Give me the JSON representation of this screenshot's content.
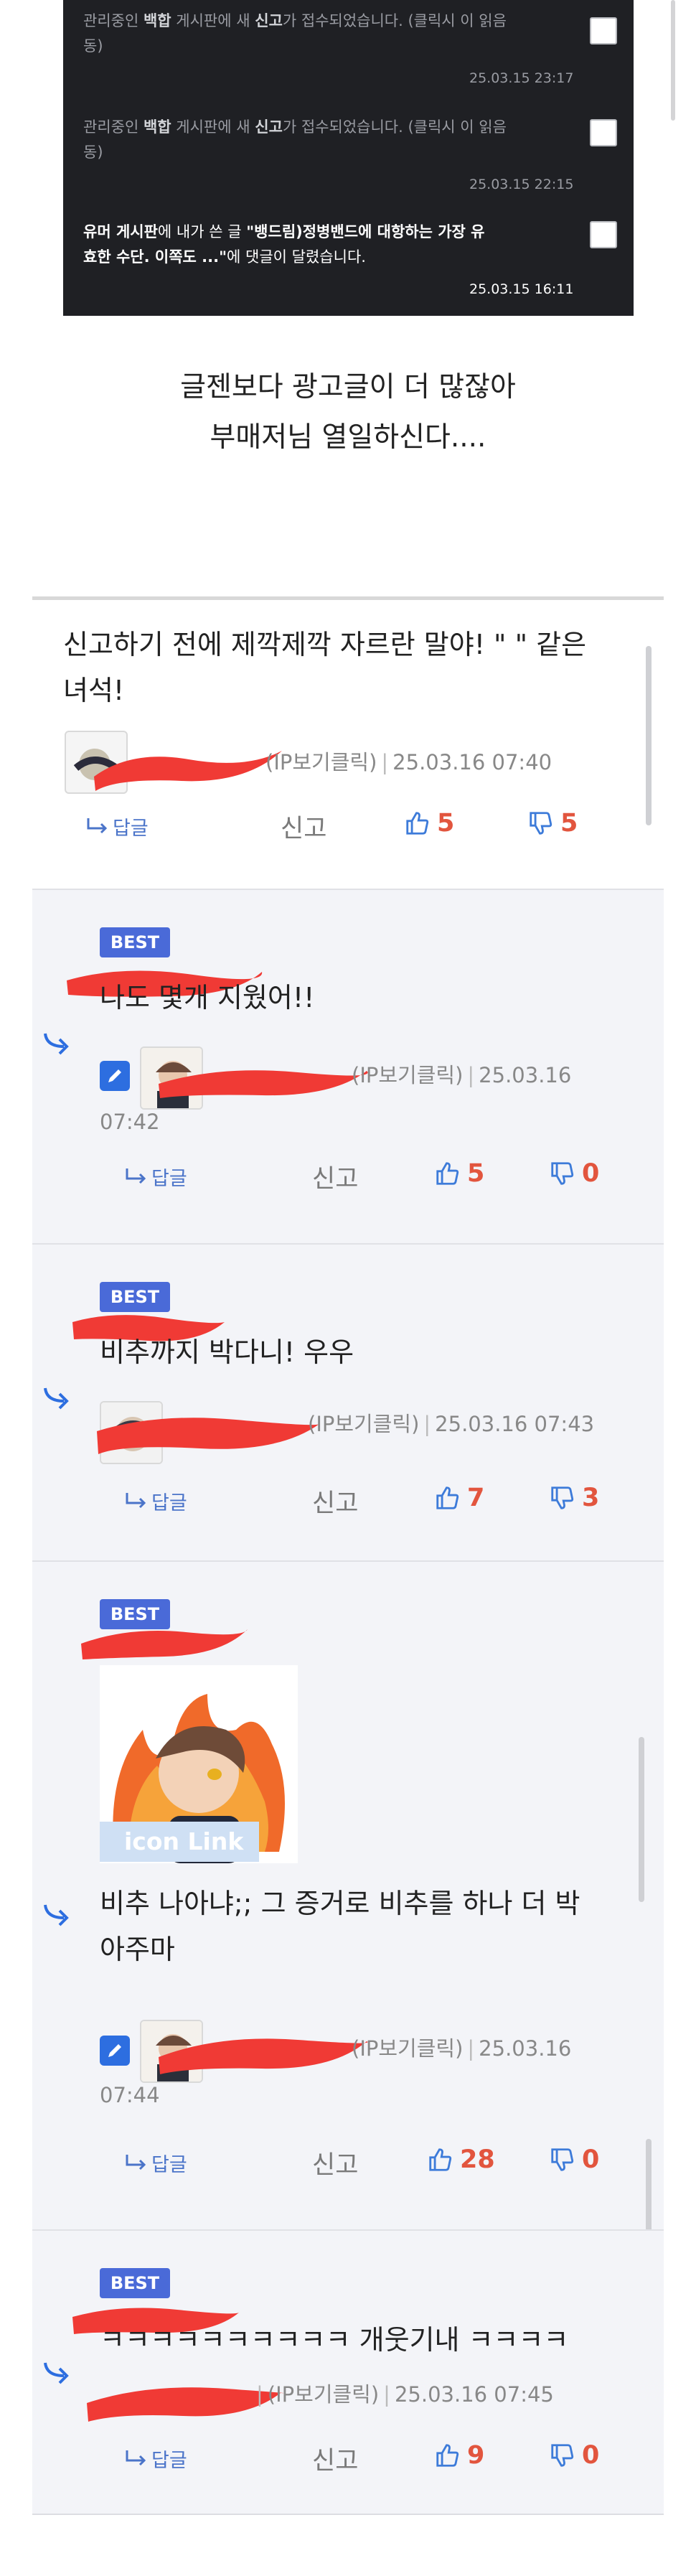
{
  "notifications": [
    {
      "prefix": "관리중인 ",
      "board": "백합",
      "middle": " 게시판에 새 ",
      "kw": "신고",
      "suffix": "가 접수되었습니다. (클릭시 이   읽음",
      "line2": "동)",
      "date": "25.03.15 23:17"
    },
    {
      "prefix": "관리중인 ",
      "board": "백합",
      "middle": " 게시판에 새 ",
      "kw": "신고",
      "suffix": "가 접수되었습니다. (클릭시 이   읽음",
      "line2": "동)",
      "date": "25.03.15 22:15"
    },
    {
      "board": "유머 게시판",
      "middle": "에 내가 쓴 글 ",
      "title": "\"뱅드림)정병밴드에 대항하는 가장 유",
      "line2_bold": "효한 수단. 이쪽도 ...\"",
      "line2": "에 댓글이 달렸습니다.",
      "date": "25.03.15 16:11"
    }
  ],
  "post": {
    "line1": "글젠보다 광고글이 더 많잖아",
    "line2": "부매저님 열일하신다...."
  },
  "comments": [
    {
      "text1": "신고하기 전에 제깍제깍 자르란 말야! \" \" 같은",
      "text2": "녀석!",
      "ip": "(IP보기클릭)",
      "sep": "|",
      "date": "25.03.16 07:40",
      "reply": "답글",
      "report": "신고",
      "likes": "5",
      "dislikes": "5"
    },
    {
      "badge": "BEST",
      "text1": "나도 몇개 지웠어!!",
      "ip": "(IP보기클릭)",
      "sep": "|",
      "date": "25.03.16",
      "time": "07:42",
      "reply": "답글",
      "report": "신고",
      "likes": "5",
      "dislikes": "0"
    },
    {
      "badge": "BEST",
      "text1": "비추까지 박다니! 우우",
      "ip": "(IP보기클릭)",
      "sep": "|",
      "date": "25.03.16 07:43",
      "reply": "답글",
      "report": "신고",
      "likes": "7",
      "dislikes": "3"
    },
    {
      "badge": "BEST",
      "icon_link": "icon Link",
      "text1": "비추 나아냐;; 그 증거로 비추를 하나 더 박",
      "text2": "아주마",
      "ip": "(IP보기클릭)",
      "sep": "|",
      "date": "25.03.16",
      "time": "07:44",
      "reply": "답글",
      "report": "신고",
      "likes": "28",
      "dislikes": "0"
    },
    {
      "badge": "BEST",
      "text1": "ㅋㅋㅋㅋㅋㅋㅋㅋㅋㅋ 개웃기내 ㅋㅋㅋㅋ",
      "ip": "(IP보기클릭)",
      "sep": "|",
      "date": "25.03.16 07:45",
      "reply": "답글",
      "report": "신고",
      "likes": "9",
      "dislikes": "0"
    }
  ],
  "colors": {
    "accent": "#4a6ad8",
    "like": "#e2553e",
    "reply_link": "#4b74c9",
    "redaction": "#f03a35"
  },
  "icons": [
    "reply-arrow-icon",
    "pencil-icon",
    "thumbs-up-icon",
    "thumbs-down-icon",
    "checkbox-icon"
  ]
}
